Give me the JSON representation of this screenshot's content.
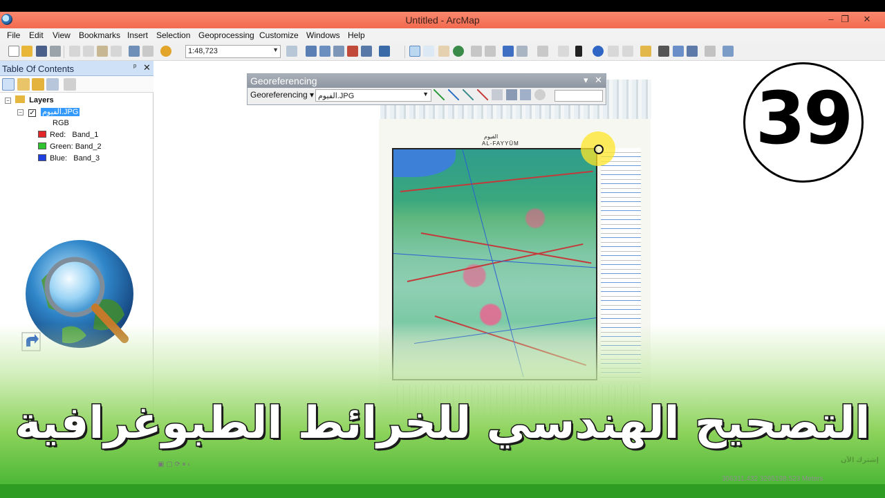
{
  "window": {
    "title": "Untitled - ArcMap",
    "minimize_glyph": "–",
    "restore_glyph": "❐",
    "close_glyph": "✕"
  },
  "menu": [
    "File",
    "Edit",
    "View",
    "Bookmarks",
    "Insert",
    "Selection",
    "Geoprocessing",
    "Customize",
    "Windows",
    "Help"
  ],
  "toolbar": {
    "scale": "1:48,723"
  },
  "toc": {
    "title": "Table Of Contents",
    "pin_glyph": "ᵖ",
    "close_glyph": "✕",
    "layers_root": "Layers",
    "layer_name": "الفيوم.JPG",
    "render_type": "RGB",
    "bands": [
      {
        "channel": "Red:",
        "band": "Band_1",
        "color": "#e3262a"
      },
      {
        "channel": "Green:",
        "band": "Band_2",
        "color": "#2fc32f"
      },
      {
        "channel": "Blue:",
        "band": "Band_3",
        "color": "#1f3fe0"
      }
    ]
  },
  "georeferencing": {
    "title": "Georeferencing",
    "menu_label": "Georeferencing",
    "layer": "الفيوم.JPG",
    "pin_glyph": "▾",
    "close_glyph": "✕"
  },
  "map_sheet": {
    "title_ar": "الفيوم",
    "title_en": "AL-FAYYŪM"
  },
  "episode_number": "39",
  "video_title": "التصحيح الهندسي للخرائط الطبوغرافية",
  "status": {
    "coordinates": "306311.432  3265198.523 Meters"
  },
  "watermark": "إشترك الآن",
  "colors": {
    "title_bar": "#f36a4f",
    "toc_header": "#cfe1f7",
    "selected_layer": "#3399ff",
    "band_green": "#3bb02c"
  }
}
